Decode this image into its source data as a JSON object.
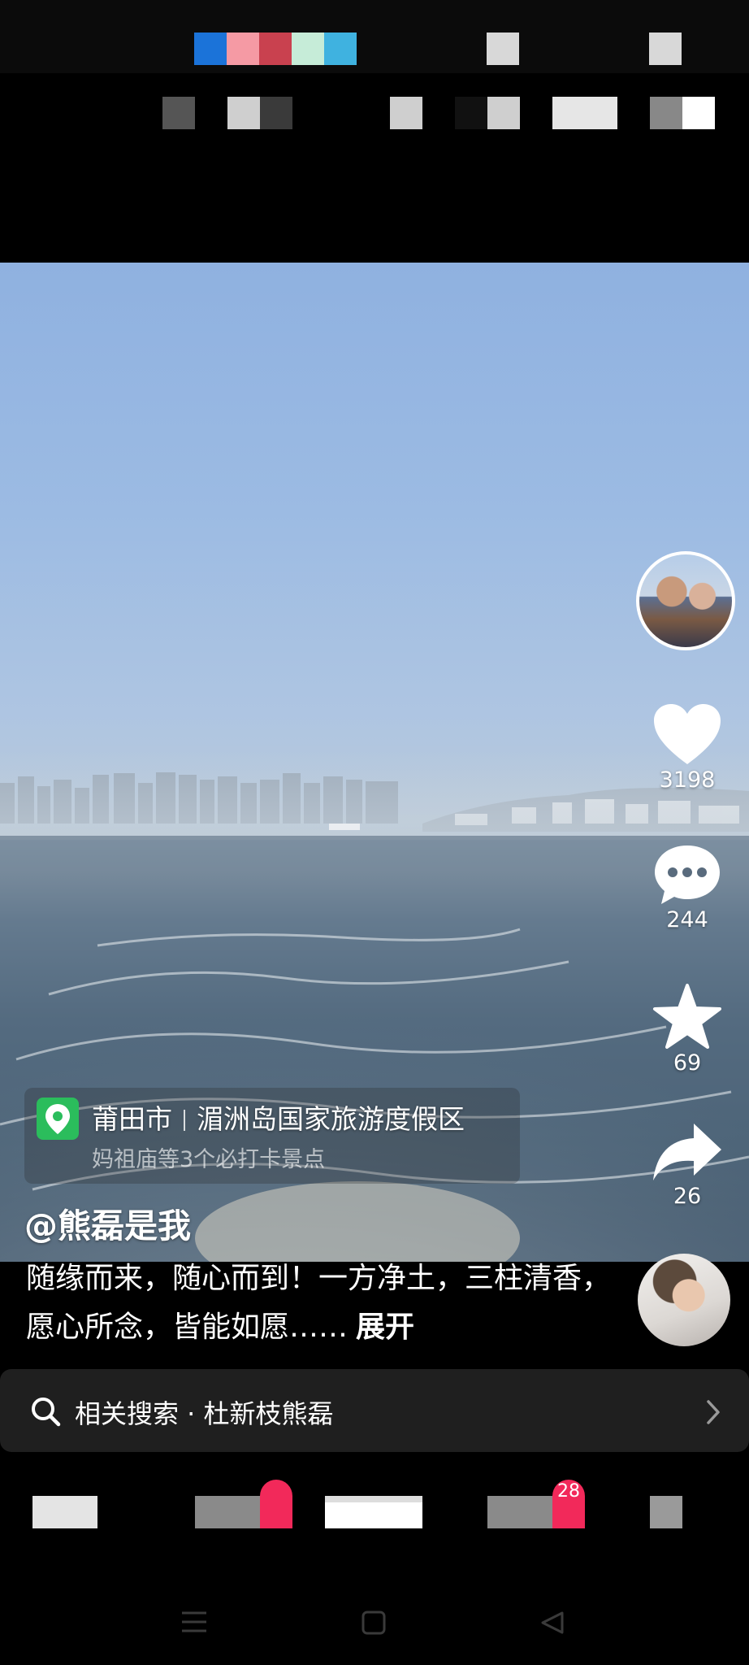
{
  "colors": {
    "location_pin_bg": "#2bbd5c",
    "badge": "#f2295a",
    "related_bg": "#1f1f1f"
  },
  "rail": {
    "avatar_icon": "user-avatar",
    "like_count": "3198",
    "comment_count": "244",
    "favorite_count": "69",
    "share_count": "26"
  },
  "location": {
    "icon": "location-pin-icon",
    "city": "莆田市",
    "place": "湄洲岛国家旅游度假区",
    "subtitle": "妈祖庙等3个必打卡景点"
  },
  "post": {
    "author": "@熊磊是我",
    "caption": "随缘而来，随心而到！一方净土，三柱清香，愿心所念，皆能如愿……",
    "expand_label": "展开"
  },
  "related_search": {
    "label": "相关搜索 · 杜新枝熊磊"
  },
  "bottom_nav": {
    "badge_count": "28"
  }
}
